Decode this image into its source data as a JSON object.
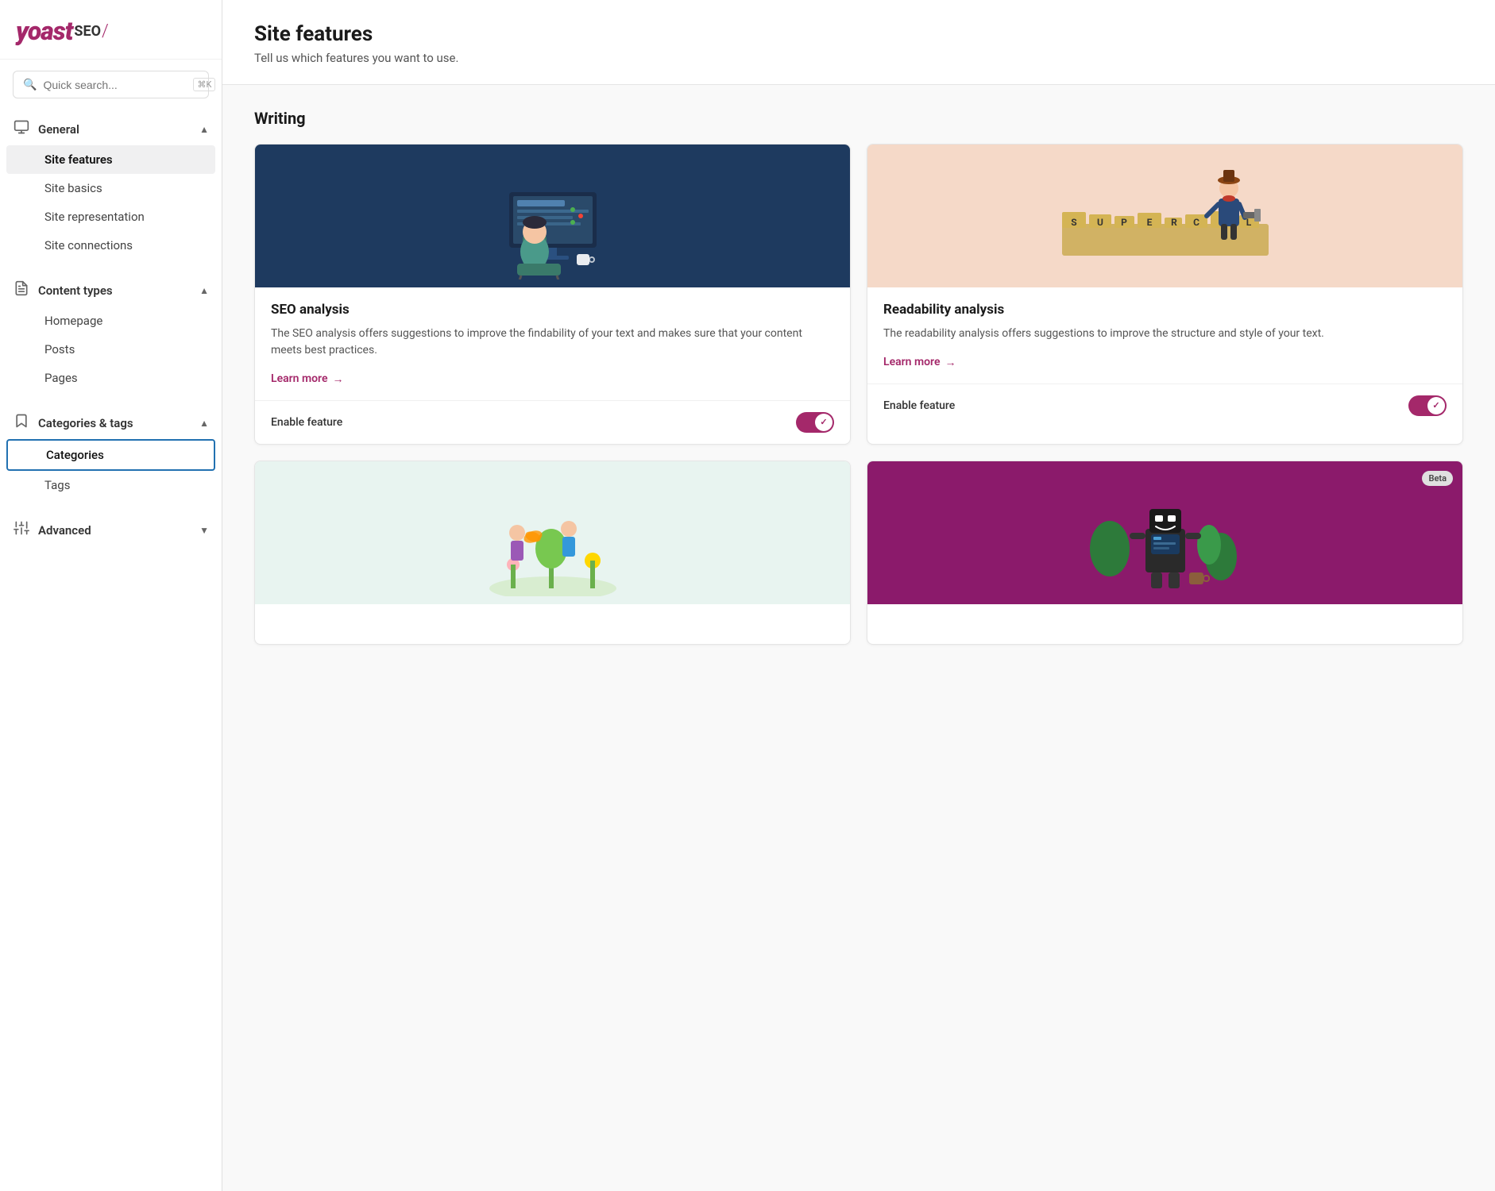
{
  "logo": {
    "yoast": "yoast",
    "seo": "SEO",
    "slash": "/"
  },
  "search": {
    "placeholder": "Quick search...",
    "shortcut": "⌘K"
  },
  "sidebar": {
    "sections": [
      {
        "id": "general",
        "label": "General",
        "icon": "monitor",
        "expanded": true,
        "items": [
          {
            "id": "site-features",
            "label": "Site features",
            "active": true
          },
          {
            "id": "site-basics",
            "label": "Site basics",
            "active": false
          },
          {
            "id": "site-representation",
            "label": "Site representation",
            "active": false
          },
          {
            "id": "site-connections",
            "label": "Site connections",
            "active": false
          }
        ]
      },
      {
        "id": "content-types",
        "label": "Content types",
        "icon": "document",
        "expanded": true,
        "items": [
          {
            "id": "homepage",
            "label": "Homepage",
            "active": false
          },
          {
            "id": "posts",
            "label": "Posts",
            "active": false
          },
          {
            "id": "pages",
            "label": "Pages",
            "active": false
          }
        ]
      },
      {
        "id": "categories-tags",
        "label": "Categories & tags",
        "icon": "bookmark",
        "expanded": true,
        "items": [
          {
            "id": "categories",
            "label": "Categories",
            "active": false,
            "selected": true
          },
          {
            "id": "tags",
            "label": "Tags",
            "active": false
          }
        ]
      },
      {
        "id": "advanced",
        "label": "Advanced",
        "icon": "sliders",
        "expanded": false,
        "items": []
      }
    ]
  },
  "page": {
    "title": "Site features",
    "subtitle": "Tell us which features you want to use."
  },
  "writing_section": {
    "heading": "Writing",
    "cards": [
      {
        "id": "seo-analysis",
        "title": "SEO analysis",
        "description": "The SEO analysis offers suggestions to improve the findability of your text and makes sure that your content meets best practices.",
        "learn_more": "Learn more",
        "arrow": "→",
        "enable_label": "Enable feature",
        "enabled": true,
        "image_bg": "blue-bg",
        "beta": false
      },
      {
        "id": "readability-analysis",
        "title": "Readability analysis",
        "description": "The readability analysis offers suggestions to improve the structure and style of your text.",
        "learn_more": "Learn more",
        "arrow": "→",
        "enable_label": "Enable feature",
        "enabled": true,
        "image_bg": "peach-bg",
        "beta": false
      },
      {
        "id": "card-3",
        "title": "",
        "description": "",
        "learn_more": "",
        "arrow": "",
        "enable_label": "",
        "enabled": false,
        "image_bg": "light-bg",
        "beta": false
      },
      {
        "id": "card-4",
        "title": "",
        "description": "",
        "learn_more": "",
        "arrow": "",
        "enable_label": "",
        "enabled": false,
        "image_bg": "purple-bg",
        "beta": true,
        "beta_label": "Beta"
      }
    ]
  }
}
